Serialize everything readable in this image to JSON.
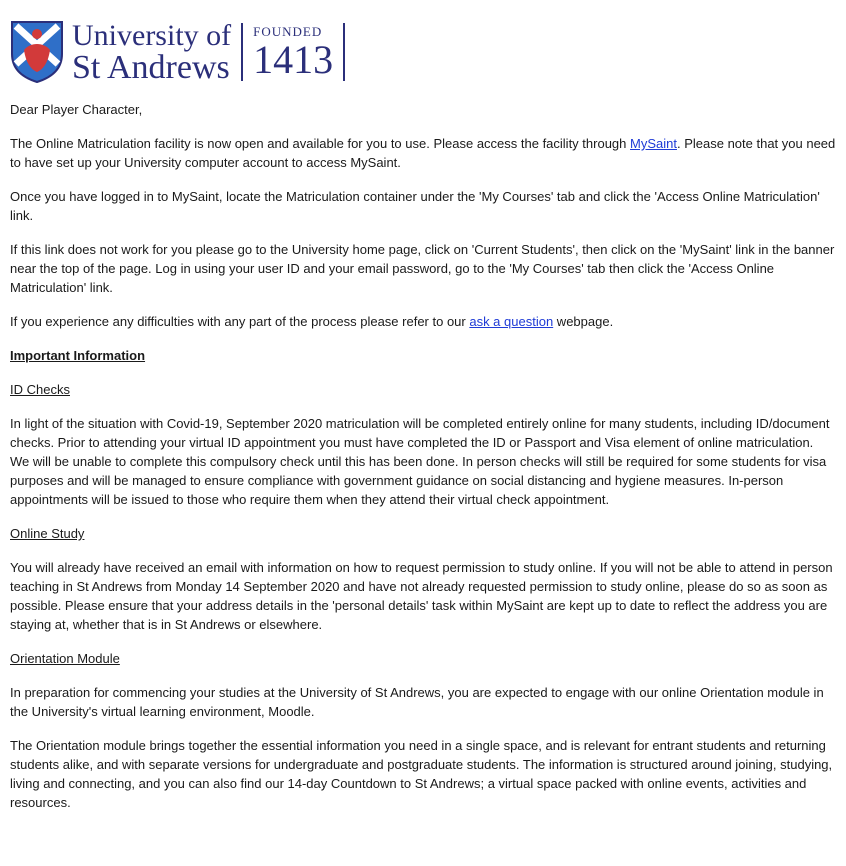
{
  "header": {
    "logo_line1": "University of",
    "logo_line2": "St Andrews",
    "founded_label": "FOUNDED",
    "founded_year": "1413"
  },
  "greeting": "Dear Player Character,",
  "p1": {
    "before": "The Online Matriculation facility is now open and available for you to use. Please access the facility through ",
    "link": "MySaint",
    "after": ". Please note that you need to have set up your University computer account to access MySaint."
  },
  "p2": "Once you have logged in to MySaint, locate the Matriculation container under the 'My Courses' tab and click the 'Access Online Matriculation' link.",
  "p3": "If this link does not work for you please go to the University home page, click on 'Current Students', then click on the 'MySaint' link in the banner near the top of the page. Log in using your user ID and your email password, go to the 'My Courses' tab then click the 'Access Online Matriculation' link.",
  "p4": {
    "before": "If you experience any difficulties with any part of the process please refer to our ",
    "link": "ask a question",
    "after": " webpage."
  },
  "important_heading": "Important Information",
  "id_checks": {
    "title": "ID Checks",
    "body": "In light of the situation with Covid-19, September 2020 matriculation will be completed entirely online for many students, including ID/document checks. Prior to attending your virtual ID appointment you must have completed the ID or Passport and Visa element of online matriculation. We will be unable to complete this compulsory check until this has been done. In person checks will still be required for some students for visa purposes and will be managed to ensure compliance with government guidance on social distancing and hygiene measures. In-person appointments will be issued to those who require them when they attend their virtual check appointment."
  },
  "online_study": {
    "title": "Online Study",
    "body": "You will already have received an email with information on how to request permission to study online. If you will not be able to attend in person teaching in St Andrews from Monday 14 September 2020 and have not already requested permission to study online, please do so as soon as possible. Please ensure that your address details in the 'personal details' task within MySaint are kept up to date to reflect the address you are staying at, whether that is in St Andrews or elsewhere."
  },
  "orientation": {
    "title": "Orientation Module",
    "body1": "In preparation for commencing your studies at the University of St Andrews, you are expected to engage with our online Orientation module in the University's virtual learning environment, Moodle.",
    "body2": "The Orientation module brings together the essential information you need in a single space, and is relevant for entrant students and returning students alike, and with separate versions for undergraduate and postgraduate students. The information is structured around joining, studying, living and connecting, and you can also find our 14-day Countdown to St Andrews; a virtual space packed with online events, activities and resources."
  },
  "colors": {
    "brand_navy": "#2b2f7a",
    "crest_blue": "#2f6fc8",
    "crest_red": "#d23a3a",
    "link": "#1f3bd6"
  }
}
